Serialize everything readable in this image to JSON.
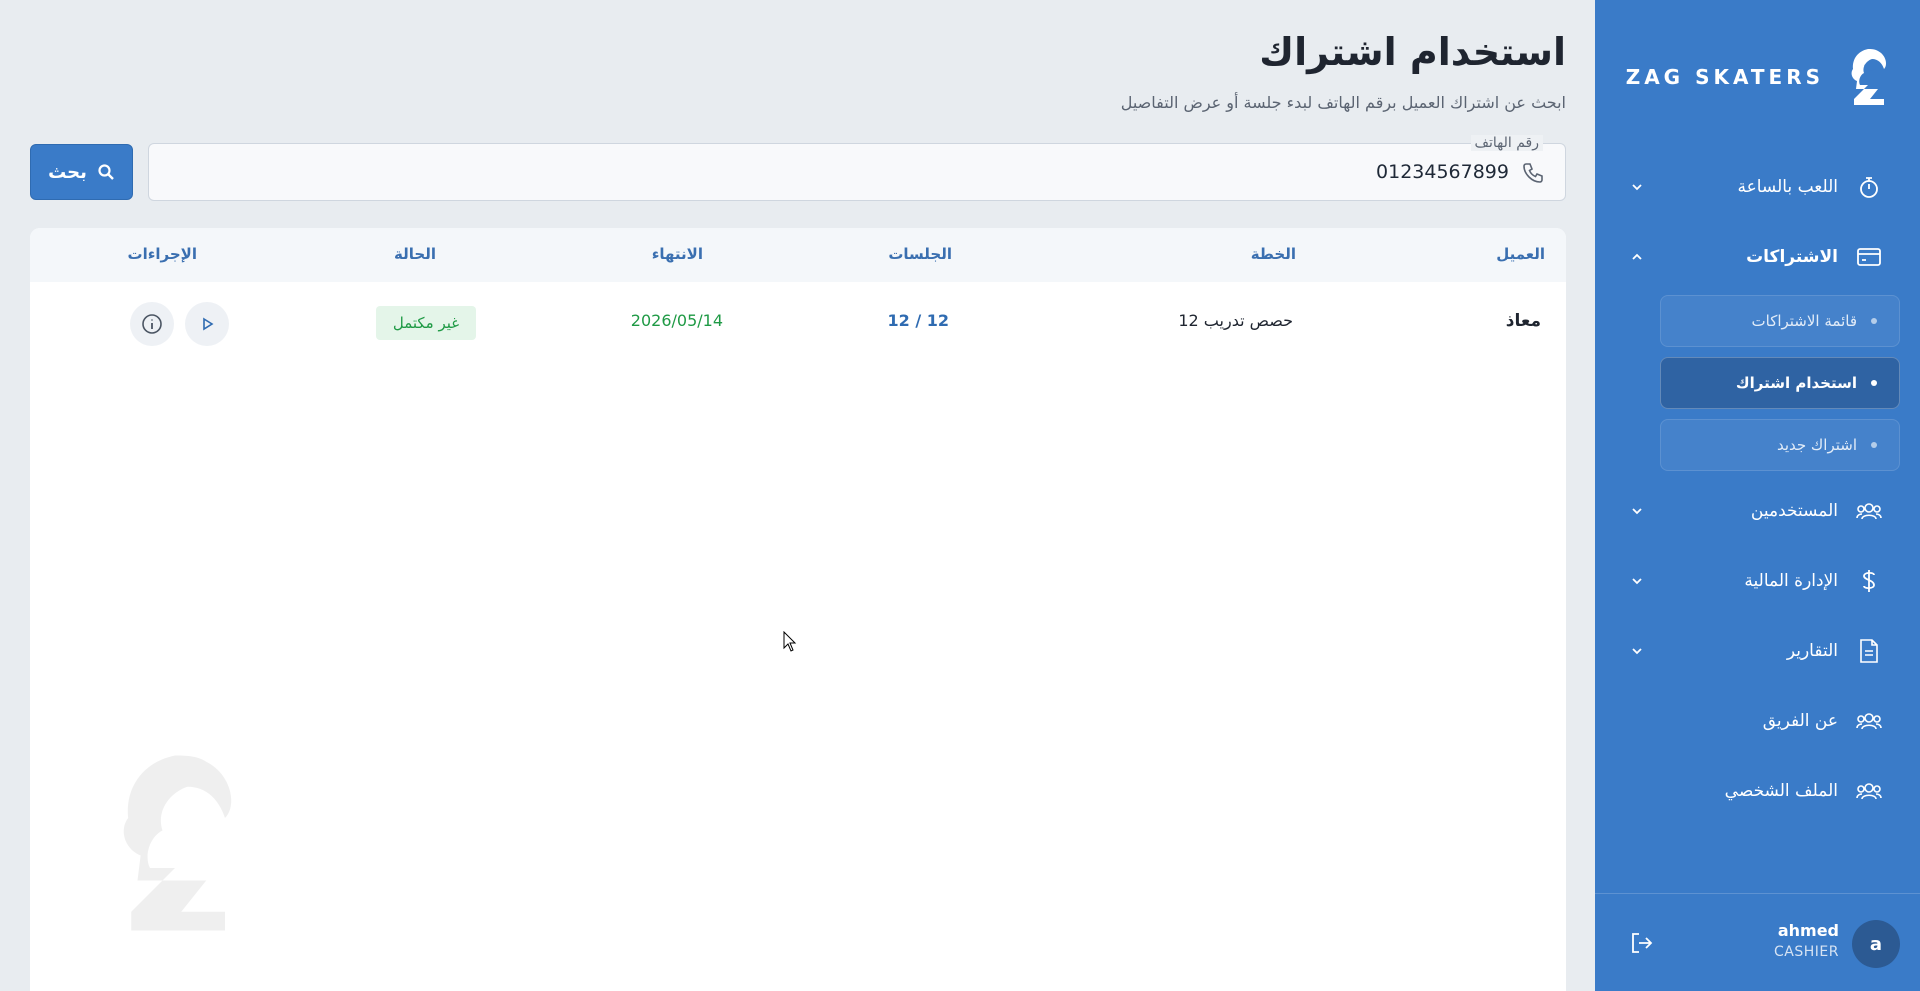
{
  "brand": {
    "name": "ZAG SKATERS",
    "primary_color": "#3a7bc8"
  },
  "sidebar": {
    "items": [
      {
        "label": "اللعب بالساعة",
        "icon": "stopwatch-icon",
        "expanded": false
      },
      {
        "label": "الاشتراكات",
        "icon": "card-icon",
        "expanded": true,
        "children": [
          {
            "label": "قائمة الاشتراكات",
            "selected": false
          },
          {
            "label": "استخدام اشتراك",
            "selected": true
          },
          {
            "label": "اشتراك جديد",
            "selected": false
          }
        ]
      },
      {
        "label": "المستخدمين",
        "icon": "users-icon",
        "expanded": false
      },
      {
        "label": "الإدارة المالية",
        "icon": "dollar-icon",
        "expanded": false
      },
      {
        "label": "التقارير",
        "icon": "document-icon",
        "expanded": false
      },
      {
        "label": "عن الفريق",
        "icon": "users-icon"
      },
      {
        "label": "الملف الشخصي",
        "icon": "users-icon"
      }
    ]
  },
  "user": {
    "initial": "a",
    "name": "ahmed",
    "role": "CASHIER"
  },
  "page": {
    "title": "استخدام اشتراك",
    "subtitle": "ابحث عن اشتراك العميل برقم الهاتف لبدء جلسة أو عرض التفاصيل"
  },
  "search": {
    "label": "رقم الهاتف",
    "value": "01234567899",
    "button_label": "بحث"
  },
  "table": {
    "columns": [
      "العميل",
      "الخطة",
      "الجلسات",
      "الانتهاء",
      "الحالة",
      "الإجراءات"
    ],
    "rows": [
      {
        "client": "معاذ",
        "plan": "12 حصص تدريب",
        "sessions": "12 / 12",
        "expiry": "2026/05/14",
        "status": "غير مكتمل"
      }
    ]
  }
}
